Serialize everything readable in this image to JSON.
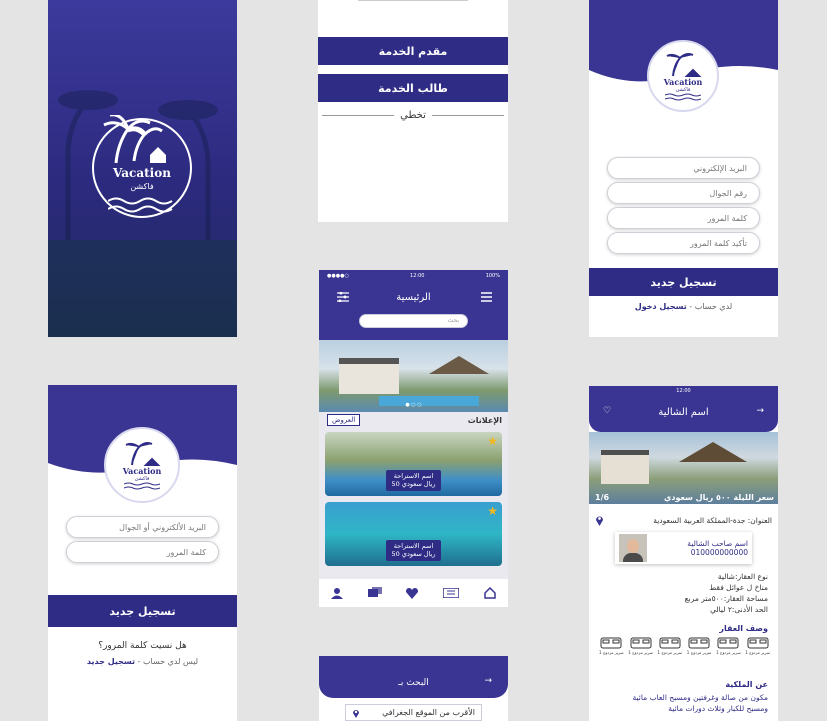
{
  "splash": {
    "brand_en": "Vacation",
    "brand_ar": "فاكشن"
  },
  "choice": {
    "provider": "مقدم الخدمة",
    "requester": "طالب الخدمة",
    "skip": "تخطي"
  },
  "register": {
    "brand_en": "Vacation",
    "brand_ar": "فاكشن",
    "email": "البريد الإلكتروني",
    "phone": "رقم الجوال",
    "password": "كلمة المرور",
    "confirm": "تأكيد كلمة المرور",
    "button": "تسجيل جديد",
    "have_account": "لدي حساب - ",
    "login": "تسجيل دخول"
  },
  "home": {
    "time": "12:00",
    "carrier": "●●●●○",
    "battery": "100%",
    "title": "الرئيسية",
    "search_placeholder": "بحث",
    "ads_label": "الإعلانات",
    "offers_label": "العروض",
    "cards": [
      {
        "name": "اسم الاستراحة",
        "price": "50 ريال سعودي"
      },
      {
        "name": "اسم الاستراحة",
        "price": "50 ريال سعودي"
      }
    ]
  },
  "login": {
    "brand_en": "Vacation",
    "brand_ar": "فاكشن",
    "email_or_phone": "البريد الألكتروني أو الجوال",
    "password": "كلمة المرور",
    "button": "تسجيل جديد",
    "forgot": "هل نسيت كلمة المرور؟",
    "no_account": "ليس لدي حساب - ",
    "register": "تسجيل جديد"
  },
  "search": {
    "title": "البحث بـ",
    "nearest": "الأقرب من الموقع الجغرافي"
  },
  "detail": {
    "time": "12:00",
    "title": "اسم الشالية",
    "price": "سعر الليلة ٥٠٠ ريال سعودي",
    "counter": "1/6",
    "address": "العنوان: جدة-المملكة العربية السعودية",
    "owner_label": "اسم صاحب الشالية",
    "owner_phone": "010000000000",
    "type": "نوع العقار:شالية",
    "suitable": "مناخ ل عوائل فقط",
    "area": "مساحة العقار:٥٠٠متر مربع",
    "min": "الحد الأدنى:٢ ليالي",
    "desc_heading": "وصف العقار",
    "bed_label": "سرير مزدوج 1",
    "about_heading": "عن الملكية",
    "about_1": "مكون من صالة وغرفتين ومسبح العاب مائية",
    "about_2": "ومسبح للكبار وثلاث دورات مائية"
  }
}
